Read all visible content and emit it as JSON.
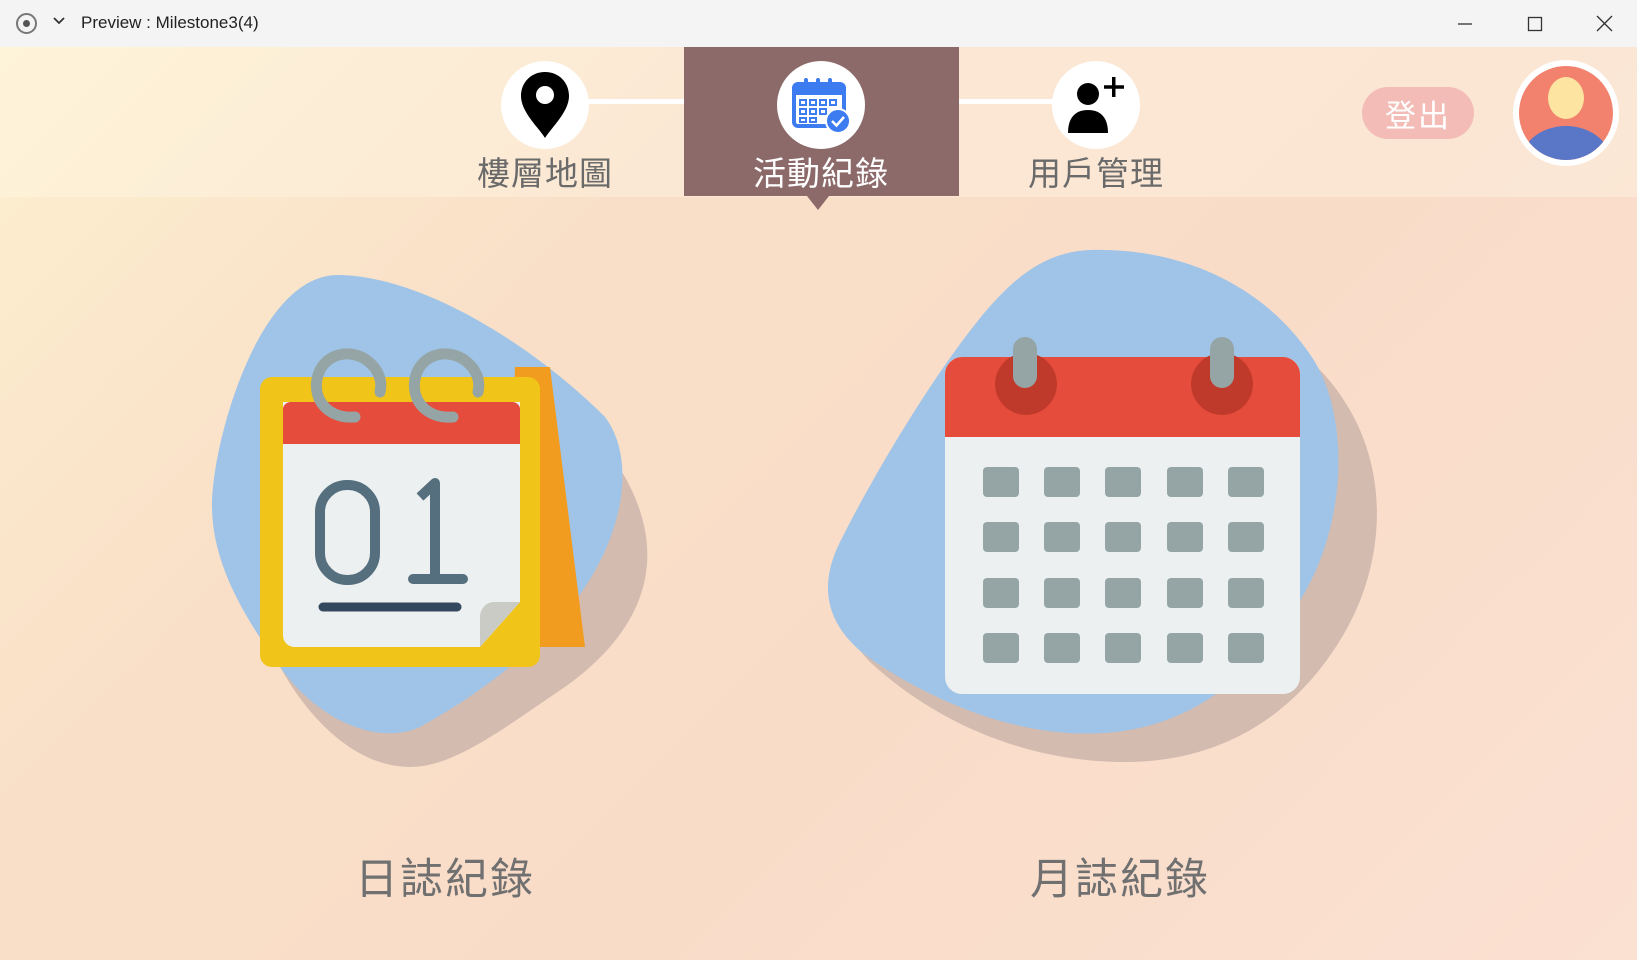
{
  "window": {
    "title": "Preview : Milestone3(4)",
    "icons": [
      "record-icon",
      "chevron-down-icon",
      "minimize-icon",
      "maximize-icon",
      "close-icon"
    ]
  },
  "nav": {
    "items": [
      {
        "label": "樓層地圖",
        "icon": "map-pin-icon",
        "active": false
      },
      {
        "label": "活動紀錄",
        "icon": "calendar-check-icon",
        "active": true
      },
      {
        "label": "用戶管理",
        "icon": "add-user-icon",
        "active": false
      }
    ],
    "active_color": "#8c6a6a"
  },
  "header": {
    "logout_label": "登出",
    "avatar_icon": "user-avatar-icon"
  },
  "main": {
    "cards": [
      {
        "label": "日誌紀錄",
        "icon": "daily-calendar-icon",
        "day_number": "01"
      },
      {
        "label": "月誌紀錄",
        "icon": "monthly-calendar-icon"
      }
    ]
  },
  "colors": {
    "blob_blue": "#9fc4e7",
    "blob_shadow": "#d3bbb0",
    "calendar_red": "#e64c3c",
    "calendar_yellow": "#f1c419",
    "calendar_grey": "#95a5a5",
    "logout_bg": "#f3bcb6"
  }
}
